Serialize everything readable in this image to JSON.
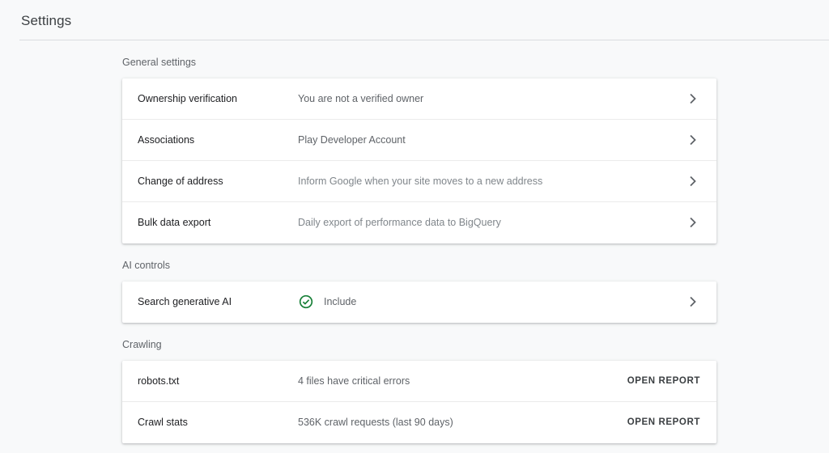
{
  "header": {
    "title": "Settings"
  },
  "sections": {
    "general": {
      "title": "General settings",
      "rows": [
        {
          "label": "Ownership verification",
          "value": "You are not a verified owner"
        },
        {
          "label": "Associations",
          "value": "Play Developer Account"
        },
        {
          "label": "Change of address",
          "value": "Inform Google when your site moves to a new address"
        },
        {
          "label": "Bulk data export",
          "value": "Daily export of performance data to BigQuery"
        }
      ]
    },
    "ai": {
      "title": "AI controls",
      "rows": [
        {
          "label": "Search generative AI",
          "value": "Include",
          "icon": "check-circle-icon"
        }
      ]
    },
    "crawling": {
      "title": "Crawling",
      "rows": [
        {
          "label": "robots.txt",
          "value": "4 files have critical errors",
          "action": "OPEN REPORT"
        },
        {
          "label": "Crawl stats",
          "value": "536K crawl requests (last 90 days)",
          "action": "OPEN REPORT"
        }
      ]
    }
  },
  "colors": {
    "accent_check": "#188038",
    "background": "#f8f9fa",
    "card": "#ffffff"
  }
}
